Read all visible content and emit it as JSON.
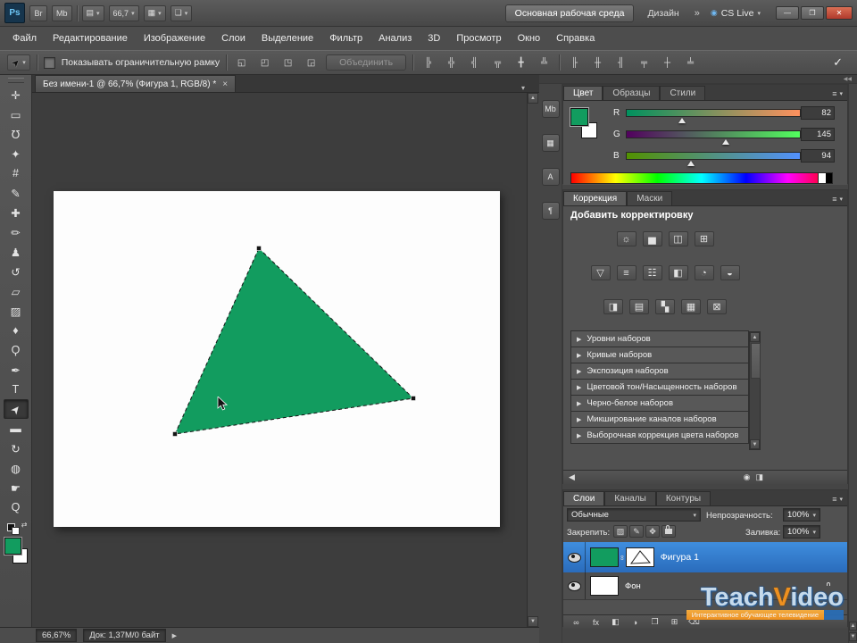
{
  "titlebar": {
    "logo": "Ps",
    "br": "Br",
    "mb": "Mb",
    "zoom": "66,7",
    "workspace_main": "Основная рабочая среда",
    "workspace_alt": "Дизайн",
    "overflow": "»",
    "cs_live": "CS Live"
  },
  "menubar": {
    "items": [
      "Файл",
      "Редактирование",
      "Изображение",
      "Слои",
      "Выделение",
      "Фильтр",
      "Анализ",
      "3D",
      "Просмотр",
      "Окно",
      "Справка"
    ]
  },
  "options": {
    "show_bbox_label": "Показывать ограничительную рамку",
    "combine_label": "Объединить"
  },
  "doc": {
    "tab_title": "Без имени-1 @ 66,7% (Фигура 1, RGB/8) *"
  },
  "tools": [
    {
      "name": "move-tool",
      "glyph": "✛"
    },
    {
      "name": "rectangular-marquee-tool",
      "glyph": "▭"
    },
    {
      "name": "lasso-tool",
      "glyph": "℧"
    },
    {
      "name": "quick-selection-tool",
      "glyph": "✦"
    },
    {
      "name": "crop-tool",
      "glyph": "#"
    },
    {
      "name": "eyedropper-tool",
      "glyph": "✎"
    },
    {
      "name": "healing-brush-tool",
      "glyph": "✚"
    },
    {
      "name": "brush-tool",
      "glyph": "✏"
    },
    {
      "name": "clone-stamp-tool",
      "glyph": "♟"
    },
    {
      "name": "history-brush-tool",
      "glyph": "↺"
    },
    {
      "name": "eraser-tool",
      "glyph": "▱"
    },
    {
      "name": "gradient-tool",
      "glyph": "▨"
    },
    {
      "name": "blur-tool",
      "glyph": "♦"
    },
    {
      "name": "dodge-tool",
      "glyph": "Ϙ"
    },
    {
      "name": "pen-tool",
      "glyph": "✒"
    },
    {
      "name": "type-tool",
      "glyph": "T"
    },
    {
      "name": "path-selection-tool",
      "glyph": "➤"
    },
    {
      "name": "rectangle-tool",
      "glyph": "▬"
    },
    {
      "name": "3d-rotate-tool",
      "glyph": "↻"
    },
    {
      "name": "3d-orbit-tool",
      "glyph": "◍"
    },
    {
      "name": "hand-tool",
      "glyph": "☛"
    },
    {
      "name": "zoom-tool",
      "glyph": "Q"
    }
  ],
  "minidock": {
    "items": [
      {
        "name": "mini-bridge",
        "glyph": "Mb"
      },
      {
        "name": "histogram",
        "glyph": "▦"
      },
      {
        "name": "character",
        "glyph": "A"
      },
      {
        "name": "paragraph",
        "glyph": "¶"
      }
    ]
  },
  "color_panel": {
    "tabs": [
      "Цвет",
      "Образцы",
      "Стили"
    ],
    "channels": [
      {
        "label": "R",
        "value": "82",
        "pos": 32
      },
      {
        "label": "G",
        "value": "145",
        "pos": 57
      },
      {
        "label": "B",
        "value": "94",
        "pos": 37
      }
    ]
  },
  "adjustments": {
    "tabs": [
      "Коррекция",
      "Маски"
    ],
    "title": "Добавить корректировку",
    "icon_rows": [
      [
        "☼",
        "▅",
        "◫",
        "⊞"
      ],
      [
        "▽",
        "≡",
        "☷",
        "◧",
        "◔",
        "◒"
      ],
      [
        "◨",
        "▤",
        "▚",
        "▦",
        "⊠"
      ]
    ],
    "presets": [
      "Уровни наборов",
      "Кривые наборов",
      "Экспозиция наборов",
      "Цветовой тон/Насыщенность наборов",
      "Черно-белое наборов",
      "Микширование каналов наборов",
      "Выборочная коррекция цвета наборов"
    ]
  },
  "layers": {
    "tabs": [
      "Слои",
      "Каналы",
      "Контуры"
    ],
    "blend_mode": "Обычные",
    "opacity_label": "Непрозрачность:",
    "opacity_value": "100%",
    "lock_label": "Закрепить:",
    "fill_label": "Заливка:",
    "fill_value": "100%",
    "rows": [
      {
        "name": "Фигура 1"
      },
      {
        "name": "Фон"
      }
    ]
  },
  "watermark": {
    "teach": "Teach",
    "v": "V",
    "ideo": "ideo",
    "tagline": "Интерактивное обучающее телевидение"
  },
  "statusbar": {
    "zoom": "66,67%",
    "doc_size": "Док: 1,37М/0 байт"
  },
  "icons": {
    "dropdown": "▾",
    "panel_menu": "≡",
    "window_minimize": "—",
    "window_restore": "❐",
    "window_close": "✕",
    "tab_close": "×",
    "tab_list": "▾",
    "commit": "✓",
    "cs_live_dot": "◉",
    "view_extras": "▤",
    "arrange_docs": "▦",
    "screen_mode": "❏",
    "tool_preset_arrow": "➤",
    "path_ops": [
      "◱",
      "◰",
      "◳",
      "◲"
    ],
    "align": [
      "╠",
      "╬",
      "╣",
      "╦",
      "╋",
      "╩"
    ],
    "distribute": [
      "╟",
      "╫",
      "╢",
      "╤",
      "┼",
      "╧"
    ],
    "scroll_up": "▲",
    "scroll_down": "▼",
    "scroll_right": "▶",
    "expander": "▶",
    "swap_colors": "⇄",
    "link": "∞",
    "adj_footer_left": "◀",
    "adj_footer_icon1": "◉",
    "adj_footer_icon2": "◨",
    "lock_row": [
      "▨",
      "✎",
      "✥"
    ],
    "layer_buttons": [
      "∞",
      "fx",
      "◧",
      "◑",
      "❐",
      "⊞",
      "⌫"
    ],
    "dock_collapse": "◀◀"
  },
  "colors": {
    "shape_green": "#129c5f",
    "selection_blue": "#2f80d0",
    "watermark_orange": "#f7941d"
  }
}
